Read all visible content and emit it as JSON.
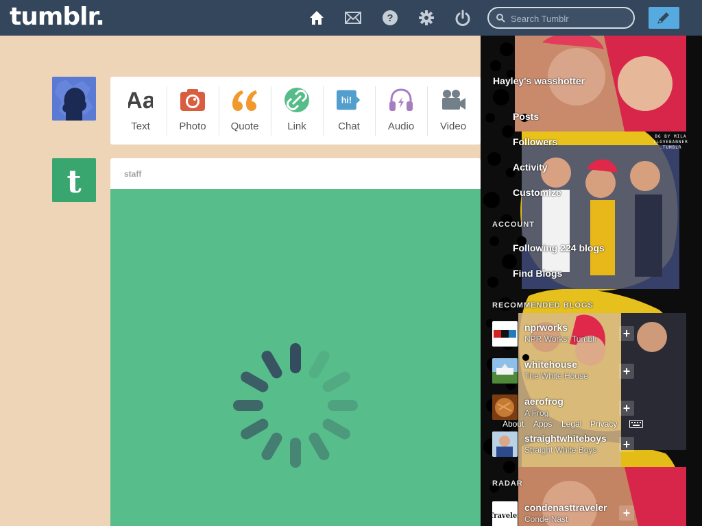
{
  "header": {
    "logo": "tumblr.",
    "search_placeholder": "Search Tumblr",
    "nav_icons": [
      "home-icon",
      "mail-icon",
      "help-icon",
      "settings-icon",
      "power-icon",
      "pencil-icon"
    ]
  },
  "post_types": [
    {
      "label": "Text",
      "icon": "text-icon",
      "color": "#444444"
    },
    {
      "label": "Photo",
      "icon": "camera-icon",
      "color": "#d95e40"
    },
    {
      "label": "Quote",
      "icon": "quote-icon",
      "color": "#f2992e"
    },
    {
      "label": "Link",
      "icon": "link-icon",
      "color": "#56bc8a"
    },
    {
      "label": "Chat",
      "icon": "chat-icon",
      "color": "#529ecc"
    },
    {
      "label": "Audio",
      "icon": "headphones-icon",
      "color": "#a77dc2"
    },
    {
      "label": "Video",
      "icon": "video-camera-icon",
      "color": "#748089"
    }
  ],
  "post": {
    "author": "staff",
    "media_color": "#57bd8a"
  },
  "sidebar": {
    "blog_name": "Hayley's wasshotter",
    "menu": [
      {
        "label": "Posts"
      },
      {
        "label": "Followers"
      },
      {
        "label": "Activity"
      },
      {
        "label": "Customize"
      }
    ],
    "account_heading": "ACCOUNT",
    "account_items": [
      {
        "label": "Following 224 blogs"
      },
      {
        "label": "Find Blogs"
      }
    ],
    "recommended_heading": "RECOMMENDED BLOGS",
    "recommended": [
      {
        "name": "nprworks",
        "sub": "NPR Works: Tumblr",
        "thumb": "npr-logo"
      },
      {
        "name": "whitehouse",
        "sub": "The White House",
        "thumb": "whitehouse-photo"
      },
      {
        "name": "aerofrog",
        "sub": "A Frog",
        "thumb": "bread-photo"
      },
      {
        "name": "straightwhiteboys",
        "sub": "Straight White Boys",
        "thumb": "portrait-photo"
      },
      {
        "name": "condenasttraveler",
        "sub": "Condé Nast",
        "thumb": "traveler-logo"
      }
    ],
    "radar_heading": "RADAR",
    "footer_links": [
      "About",
      "Apps",
      "Legal",
      "Privacy"
    ],
    "credit": "BG BY MILA\nILOVEBANNER\n.TUMBLR"
  }
}
